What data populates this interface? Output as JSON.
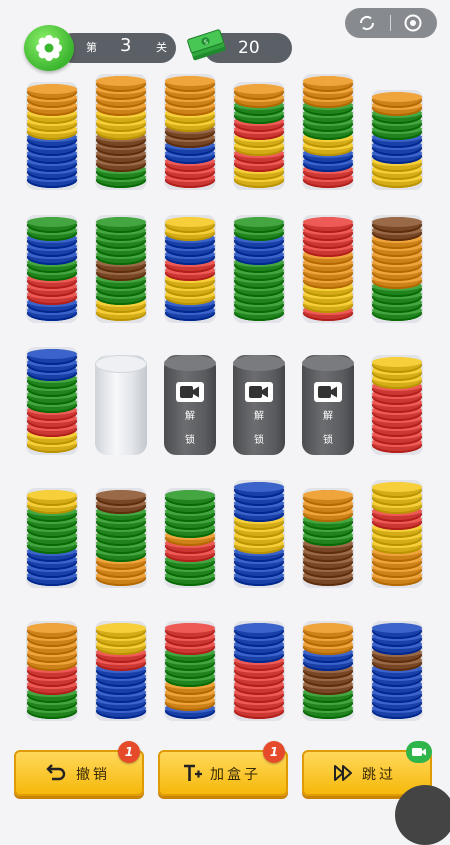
{
  "header": {
    "level_prefix": "第",
    "level_number": "3",
    "level_suffix": "关",
    "money_amount": "20"
  },
  "icons": {
    "settings": "gear-icon",
    "money": "money-stack-icon",
    "capsule_left": "refresh-icon",
    "capsule_right": "target-icon"
  },
  "colors": {
    "O": "#f0a43c",
    "Y": "#f6cf3a",
    "B": "#3b63c9",
    "G": "#44a640",
    "R": "#ee5b57",
    "N": "#9a6a48"
  },
  "tubes": [
    {
      "type": "stack",
      "discs": "OOOYYYBBBBBB"
    },
    {
      "type": "stack",
      "discs": "OOOOYYYNNNNGG"
    },
    {
      "type": "stack",
      "discs": "OOOOYYNNBBRRR"
    },
    {
      "type": "stack",
      "discs": "OOGGRRYYRRYY"
    },
    {
      "type": "stack",
      "discs": "OOOGGGGYYBBRR"
    },
    {
      "type": "stack",
      "discs": "OOGGGBBBYYY"
    },
    {
      "type": "stack",
      "discs": "GGBBBGGRRRBB"
    },
    {
      "type": "stack",
      "discs": "GGGGGNNGGGYY"
    },
    {
      "type": "stack",
      "discs": "YYBBBRRYYYBB"
    },
    {
      "type": "stack",
      "discs": "GGBBBGGGGGGG"
    },
    {
      "type": "stack",
      "discs": "RRRROOOOYYYR"
    },
    {
      "type": "stack",
      "discs": "NNOOOOOOGGGG"
    },
    {
      "type": "stack",
      "discs": "BBBGGGGRRRYY"
    },
    {
      "type": "empty"
    },
    {
      "type": "locked"
    },
    {
      "type": "locked"
    },
    {
      "type": "locked"
    },
    {
      "type": "stack",
      "discs": "YYYRRRRRRRR"
    },
    {
      "type": "stack",
      "discs": "YYGGGGGBBBB"
    },
    {
      "type": "stack",
      "discs": "NNGGGGGGOOO"
    },
    {
      "type": "stack",
      "discs": "GGGGGORRGGG"
    },
    {
      "type": "stack",
      "discs": "BBBBYYYYBBBB"
    },
    {
      "type": "stack",
      "discs": "OOOGGGNNNNN"
    },
    {
      "type": "stack",
      "discs": "YYYRRYYYOOOO"
    },
    {
      "type": "stack",
      "discs": "OOOOORRRGGG"
    },
    {
      "type": "stack",
      "discs": "YYYRRBBBBBB"
    },
    {
      "type": "stack",
      "discs": "RRRGGGGOOOB"
    },
    {
      "type": "stack",
      "discs": "BBBBRRRRRRR"
    },
    {
      "type": "stack",
      "discs": "OOOBBNNNGGG"
    },
    {
      "type": "stack",
      "discs": "BBBNNBBBBBB"
    }
  ],
  "locked": {
    "line1": "解",
    "line2": "锁"
  },
  "buttons": {
    "undo_label": "撤销",
    "undo_badge": "1",
    "add_box_label": "加盒子",
    "add_box_badge": "1",
    "skip_label": "跳过"
  }
}
